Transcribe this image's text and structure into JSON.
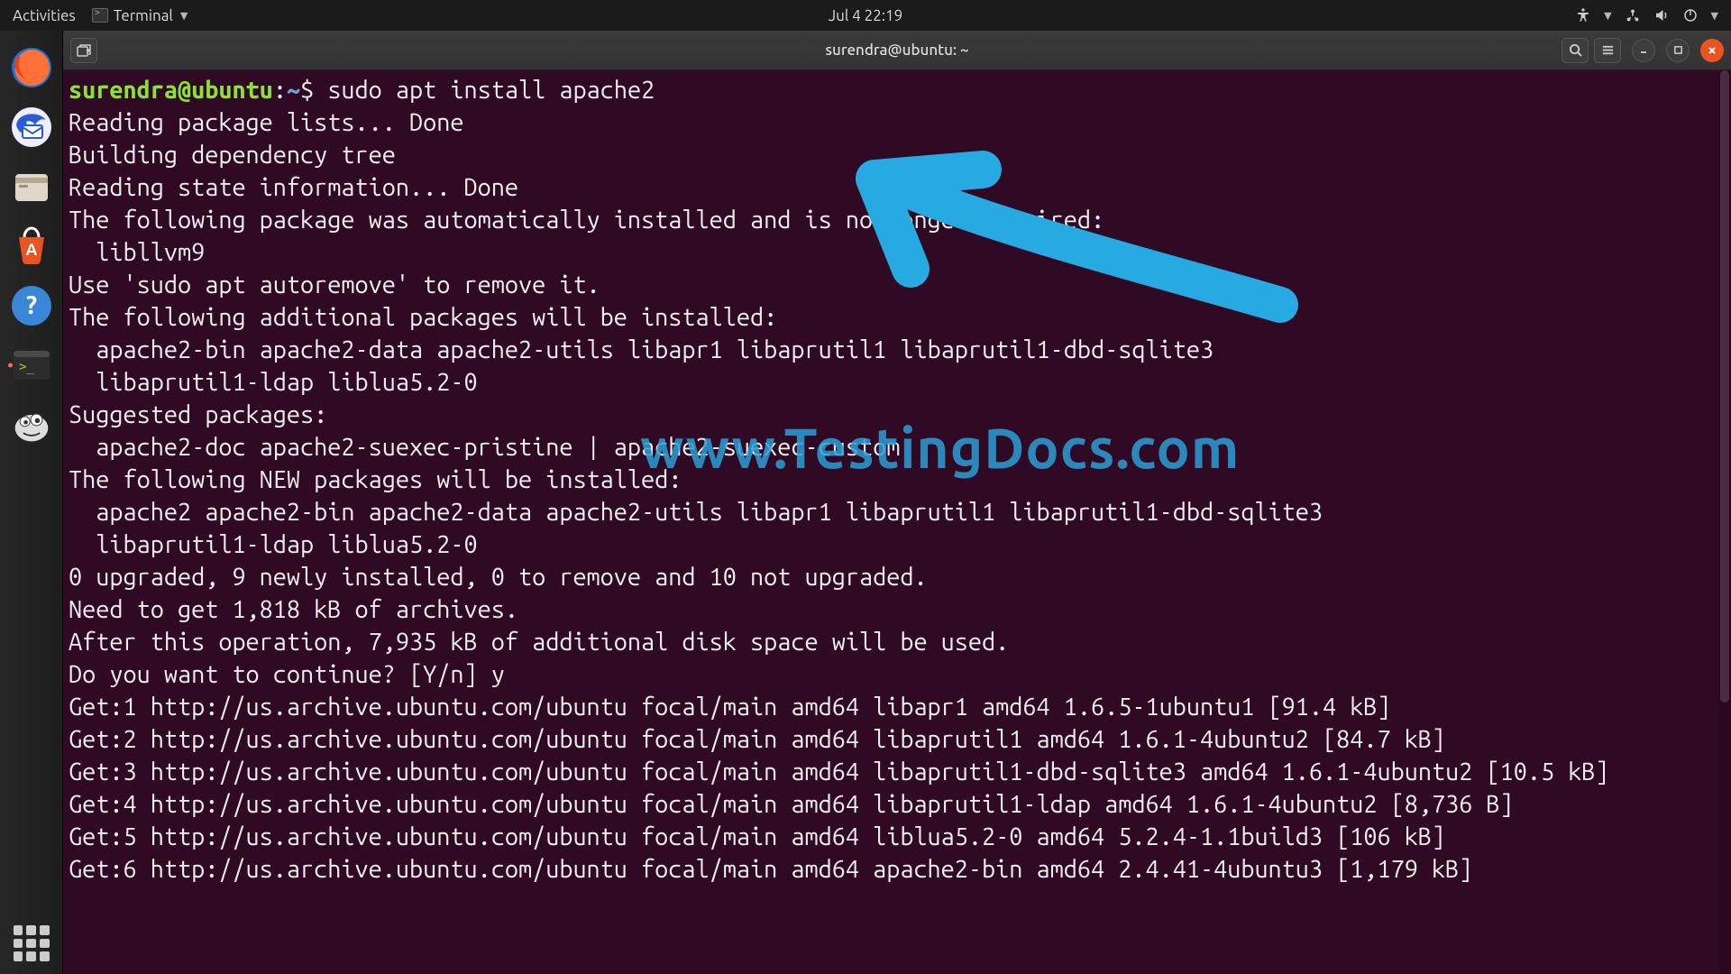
{
  "top_panel": {
    "activities": "Activities",
    "app_menu": "Terminal",
    "clock": "Jul 4  22:19"
  },
  "window": {
    "title": "surendra@ubuntu: ~"
  },
  "prompt": {
    "user_host": "surendra@ubuntu",
    "sep": ":",
    "path": "~",
    "dollar": "$ ",
    "command": "sudo apt install apache2"
  },
  "output_lines": [
    "Reading package lists... Done",
    "Building dependency tree",
    "Reading state information... Done",
    "The following package was automatically installed and is no longer required:",
    "  libllvm9",
    "Use 'sudo apt autoremove' to remove it.",
    "The following additional packages will be installed:",
    "  apache2-bin apache2-data apache2-utils libapr1 libaprutil1 libaprutil1-dbd-sqlite3",
    "  libaprutil1-ldap liblua5.2-0",
    "Suggested packages:",
    "  apache2-doc apache2-suexec-pristine | apache2-suexec-custom",
    "The following NEW packages will be installed:",
    "  apache2 apache2-bin apache2-data apache2-utils libapr1 libaprutil1 libaprutil1-dbd-sqlite3",
    "  libaprutil1-ldap liblua5.2-0",
    "0 upgraded, 9 newly installed, 0 to remove and 10 not upgraded.",
    "Need to get 1,818 kB of archives.",
    "After this operation, 7,935 kB of additional disk space will be used.",
    "Do you want to continue? [Y/n] y",
    "Get:1 http://us.archive.ubuntu.com/ubuntu focal/main amd64 libapr1 amd64 1.6.5-1ubuntu1 [91.4 kB]",
    "Get:2 http://us.archive.ubuntu.com/ubuntu focal/main amd64 libaprutil1 amd64 1.6.1-4ubuntu2 [84.7 kB]",
    "Get:3 http://us.archive.ubuntu.com/ubuntu focal/main amd64 libaprutil1-dbd-sqlite3 amd64 1.6.1-4ubuntu2 [10.5 kB]",
    "Get:4 http://us.archive.ubuntu.com/ubuntu focal/main amd64 libaprutil1-ldap amd64 1.6.1-4ubuntu2 [8,736 B]",
    "Get:5 http://us.archive.ubuntu.com/ubuntu focal/main amd64 liblua5.2-0 amd64 5.2.4-1.1build3 [106 kB]",
    "Get:6 http://us.archive.ubuntu.com/ubuntu focal/main amd64 apache2-bin amd64 2.4.41-4ubuntu3 [1,179 kB]"
  ],
  "watermark": "www.TestingDocs.com"
}
